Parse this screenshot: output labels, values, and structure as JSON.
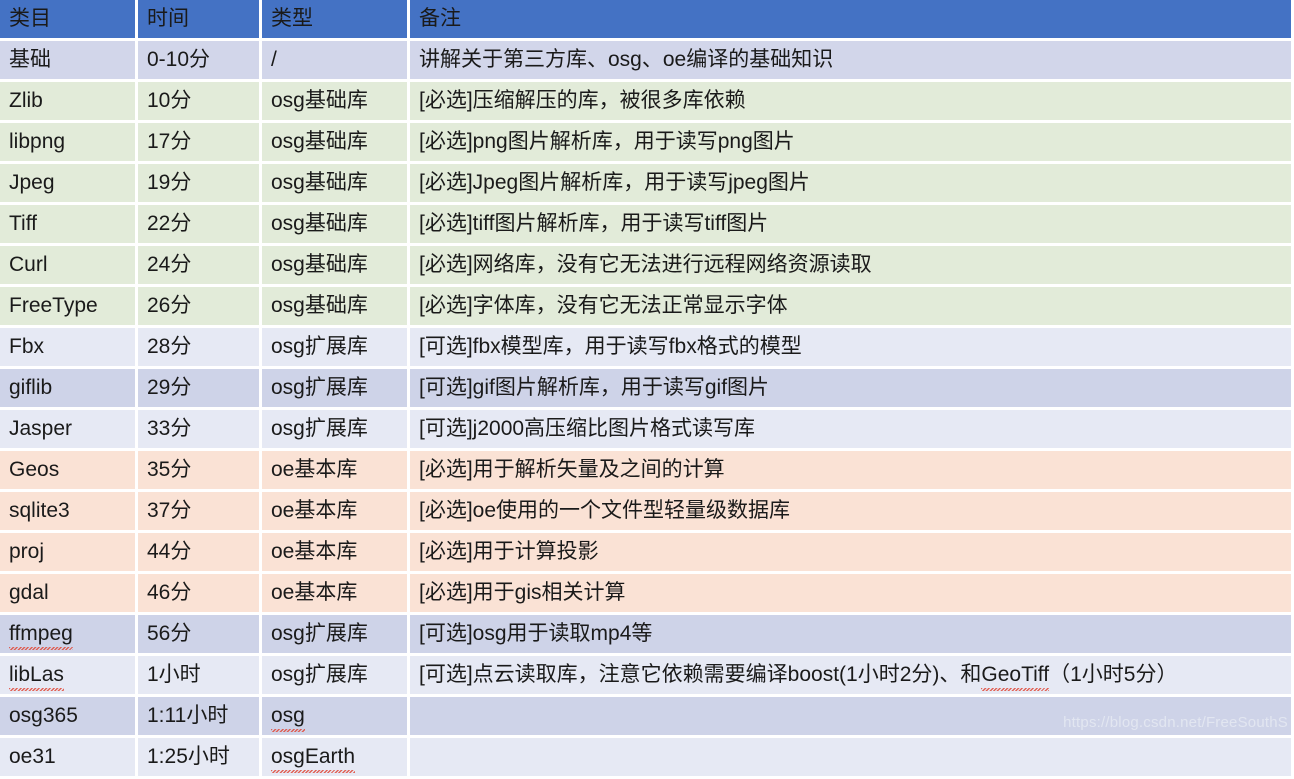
{
  "table": {
    "columns": [
      {
        "key": "category",
        "label": "类目"
      },
      {
        "key": "time",
        "label": "时间"
      },
      {
        "key": "type",
        "label": "类型"
      },
      {
        "key": "remark",
        "label": "备注"
      }
    ],
    "rows": [
      {
        "tint": "lavender",
        "category": "基础",
        "time": "0-10分",
        "type": "/",
        "remark": "讲解关于第三方库、osg、oe编译的基础知识",
        "spell_category": false,
        "spell_type": false
      },
      {
        "tint": "green",
        "category": "Zlib",
        "time": "10分",
        "type": "osg基础库",
        "remark": "[必选]压缩解压的库，被很多库依赖",
        "spell_category": false,
        "spell_type": false
      },
      {
        "tint": "green",
        "category": "libpng",
        "time": "17分",
        "type": "osg基础库",
        "remark": "[必选]png图片解析库，用于读写png图片",
        "spell_category": false,
        "spell_type": false
      },
      {
        "tint": "green",
        "category": "Jpeg",
        "time": "19分",
        "type": "osg基础库",
        "remark": "[必选]Jpeg图片解析库，用于读写jpeg图片",
        "spell_category": false,
        "spell_type": false
      },
      {
        "tint": "green",
        "category": "Tiff",
        "time": "22分",
        "type": "osg基础库",
        "remark": "[必选]tiff图片解析库，用于读写tiff图片",
        "spell_category": false,
        "spell_type": false
      },
      {
        "tint": "green",
        "category": "Curl",
        "time": "24分",
        "type": "osg基础库",
        "remark": "[必选]网络库，没有它无法进行远程网络资源读取",
        "spell_category": false,
        "spell_type": false
      },
      {
        "tint": "green",
        "category": "FreeType",
        "time": "26分",
        "type": "osg基础库",
        "remark": "[必选]字体库，没有它无法正常显示字体",
        "spell_category": false,
        "spell_type": false
      },
      {
        "tint": "palelav",
        "category": "Fbx",
        "time": "28分",
        "type": "osg扩展库",
        "remark": "[可选]fbx模型库，用于读写fbx格式的模型",
        "spell_category": false,
        "spell_type": false
      },
      {
        "tint": "deeplav",
        "category": "giflib",
        "time": "29分",
        "type": "osg扩展库",
        "remark": "[可选]gif图片解析库，用于读写gif图片",
        "spell_category": false,
        "spell_type": false
      },
      {
        "tint": "palelav",
        "category": "Jasper",
        "time": "33分",
        "type": "osg扩展库",
        "remark": "[可选]j2000高压缩比图片格式读写库",
        "spell_category": false,
        "spell_type": false
      },
      {
        "tint": "peach",
        "category": "Geos",
        "time": "35分",
        "type": "oe基本库",
        "remark": "[必选]用于解析矢量及之间的计算",
        "spell_category": false,
        "spell_type": false
      },
      {
        "tint": "peach",
        "category": "sqlite3",
        "time": "37分",
        "type": "oe基本库",
        "remark": "[必选]oe使用的一个文件型轻量级数据库",
        "spell_category": false,
        "spell_type": false
      },
      {
        "tint": "peach",
        "category": "proj",
        "time": "44分",
        "type": "oe基本库",
        "remark": "[必选]用于计算投影",
        "spell_category": false,
        "spell_type": false
      },
      {
        "tint": "peach",
        "category": "gdal",
        "time": "46分",
        "type": "oe基本库",
        "remark": "[必选]用于gis相关计算",
        "spell_category": false,
        "spell_type": false
      },
      {
        "tint": "deeplav",
        "category": "ffmpeg",
        "time": "56分",
        "type": "osg扩展库",
        "remark": "[可选]osg用于读取mp4等",
        "spell_category": true,
        "spell_type": false
      },
      {
        "tint": "palelav",
        "category": "libLas",
        "time": "1小时",
        "type": "osg扩展库",
        "remark": "[可选]点云读取库，注意它依赖需要编译boost(1小时2分)、和GeoTiff（1小时5分）",
        "remark_spell_word": "GeoTiff",
        "spell_category": true,
        "spell_type": false
      },
      {
        "tint": "deeplav",
        "category": "osg365",
        "time": "1:11小时",
        "type": "osg",
        "remark": "",
        "spell_category": false,
        "spell_type": true
      },
      {
        "tint": "palelav",
        "category": "oe31",
        "time": "1:25小时",
        "type": "osgEarth",
        "remark": "",
        "spell_category": false,
        "spell_type": true
      }
    ]
  },
  "watermark": {
    "text": "https://blog.csdn.net/FreeSouthS"
  },
  "colors": {
    "header_blue": "#4472C4",
    "row_lavender": "#d2d6ea",
    "row_green": "#e2ebd9",
    "row_pale_lavender": "#e6e9f4",
    "row_deep_lavender": "#ced3e8",
    "row_peach": "#fae2d5",
    "gridline": "#ffffff",
    "text": "#1a1a1a",
    "spellcheck_underline": "#e04a3a"
  }
}
